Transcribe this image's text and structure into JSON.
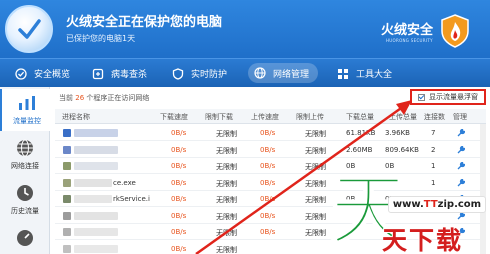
{
  "header": {
    "title": "火绒安全正在保护您的电脑",
    "subtitle": "已保护您的电脑1天",
    "brand_name": "火绒安全",
    "brand_sub": "HUORONG SECURITY"
  },
  "nav": {
    "items": [
      {
        "label": "安全概览",
        "icon": "shield-check-icon"
      },
      {
        "label": "病毒查杀",
        "icon": "virus-scan-icon"
      },
      {
        "label": "实时防护",
        "icon": "shield-icon"
      },
      {
        "label": "网络管理",
        "icon": "globe-icon"
      },
      {
        "label": "工具大全",
        "icon": "grid-icon"
      }
    ]
  },
  "sidebar": {
    "items": [
      {
        "label": "流量监控",
        "icon": "traffic-monitor-icon"
      },
      {
        "label": "网络连接",
        "icon": "network-connection-icon"
      },
      {
        "label": "历史流量",
        "icon": "history-icon"
      },
      {
        "label": "",
        "icon": "gauge-icon"
      }
    ]
  },
  "summary": {
    "prefix": "当前",
    "count": "26",
    "suffix": "个程序正在访问网络"
  },
  "show_float_label": "显示流量悬浮窗",
  "table": {
    "headers": [
      "进程名称",
      "下载速度",
      "限制下载",
      "上传速度",
      "限制上传",
      "下载总量",
      "上传总量",
      "连接数",
      "管理"
    ],
    "rows": [
      {
        "name": "",
        "down": "0B/s",
        "limit_down": "无限制",
        "up": "0B/s",
        "limit_up": "无限制",
        "total_down": "61.81KB",
        "total_up": "3.96KB",
        "conns": "7"
      },
      {
        "name": "",
        "down": "0B/s",
        "limit_down": "无限制",
        "up": "0B/s",
        "limit_up": "无限制",
        "total_down": "2.60MB",
        "total_up": "809.64KB",
        "conns": "2"
      },
      {
        "name": "",
        "down": "0B/s",
        "limit_down": "无限制",
        "up": "0B/s",
        "limit_up": "无限制",
        "total_down": "0B",
        "total_up": "0B",
        "conns": "1"
      },
      {
        "name": "ce.exe",
        "down": "0B/s",
        "limit_down": "无限制",
        "up": "0B/s",
        "limit_up": "无限制",
        "total_down": "0B",
        "total_up": "0B",
        "conns": "1"
      },
      {
        "name": "rkService.i",
        "down": "0B/s",
        "limit_down": "无限制",
        "up": "0B/s",
        "limit_up": "无限制",
        "total_down": "0B",
        "total_up": "0B",
        "conns": "1"
      },
      {
        "name": "",
        "down": "0B/s",
        "limit_down": "无限制",
        "up": "0B/s",
        "limit_up": "无限制",
        "total_down": "",
        "total_up": "",
        "conns": ""
      },
      {
        "name": "",
        "down": "0B/s",
        "limit_down": "无限制",
        "up": "0B/s",
        "limit_up": "无限制",
        "total_down": "",
        "total_up": "",
        "conns": ""
      },
      {
        "name": "",
        "down": "0B/s",
        "limit_down": "无限制",
        "up": "",
        "limit_up": "",
        "total_down": "",
        "total_up": "",
        "conns": ""
      }
    ]
  },
  "watermark": {
    "url_prefix": "www.",
    "url_mid": "TT",
    "url_suffix": "zip.com",
    "cn_text": "天下载",
    "big_char": "天"
  },
  "colors": {
    "header_blue": "#1f6fc9",
    "accent_orange": "#e8541e",
    "highlight_red": "#e0241b"
  }
}
